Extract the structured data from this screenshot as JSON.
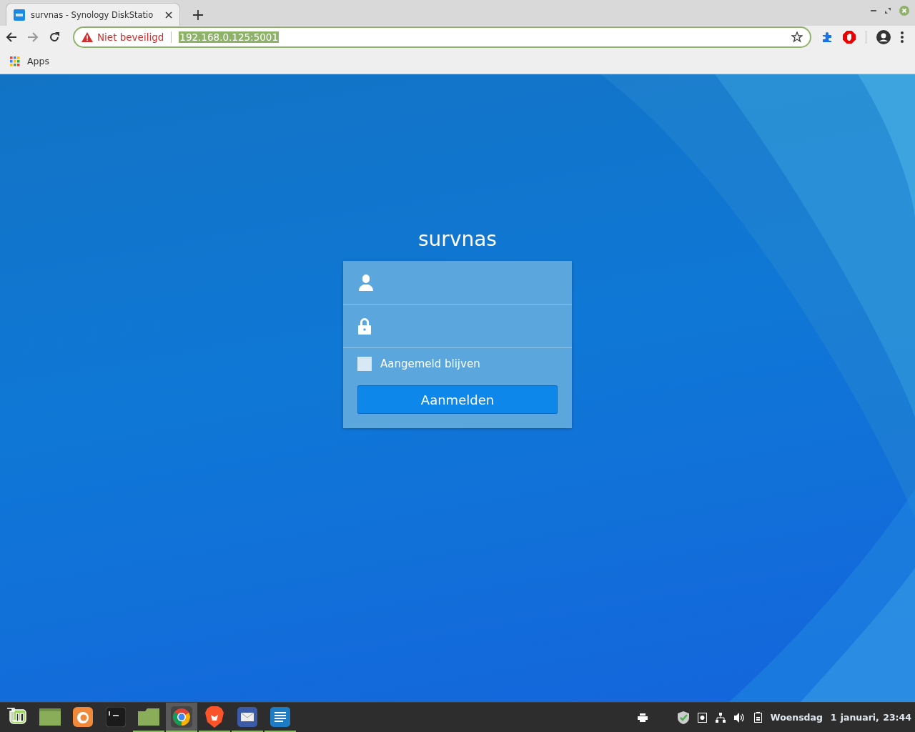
{
  "browser": {
    "tab": {
      "title": "survnas - Synology DiskStatio",
      "selected": true
    },
    "address_bar": {
      "security": "Niet beveiligd",
      "url": "192.168.0.125:5001"
    },
    "bookmarks": [
      {
        "label": "Apps"
      }
    ]
  },
  "login": {
    "title": "survnas",
    "fields": [
      {
        "kind": "user"
      },
      {
        "kind": "password"
      }
    ],
    "remember": {
      "label": "Aangemeld blijven",
      "checked": false
    },
    "submit": "Aanmelden"
  },
  "taskbar": {
    "apps": [
      {
        "kind": "mint",
        "running": false,
        "selected": false
      },
      {
        "kind": "desktop",
        "running": false,
        "selected": false
      },
      {
        "kind": "firefox",
        "running": false,
        "selected": false
      },
      {
        "kind": "terminal",
        "running": false,
        "selected": false
      },
      {
        "kind": "files",
        "running": true,
        "selected": false
      },
      {
        "kind": "chrome",
        "running": true,
        "selected": true
      },
      {
        "kind": "brave",
        "running": true,
        "selected": false
      },
      {
        "kind": "mail",
        "running": true,
        "selected": false
      },
      {
        "kind": "writer",
        "running": true,
        "selected": false
      }
    ],
    "clock": {
      "day": "Woensdag",
      "date": "1 januari, 23:44"
    }
  }
}
